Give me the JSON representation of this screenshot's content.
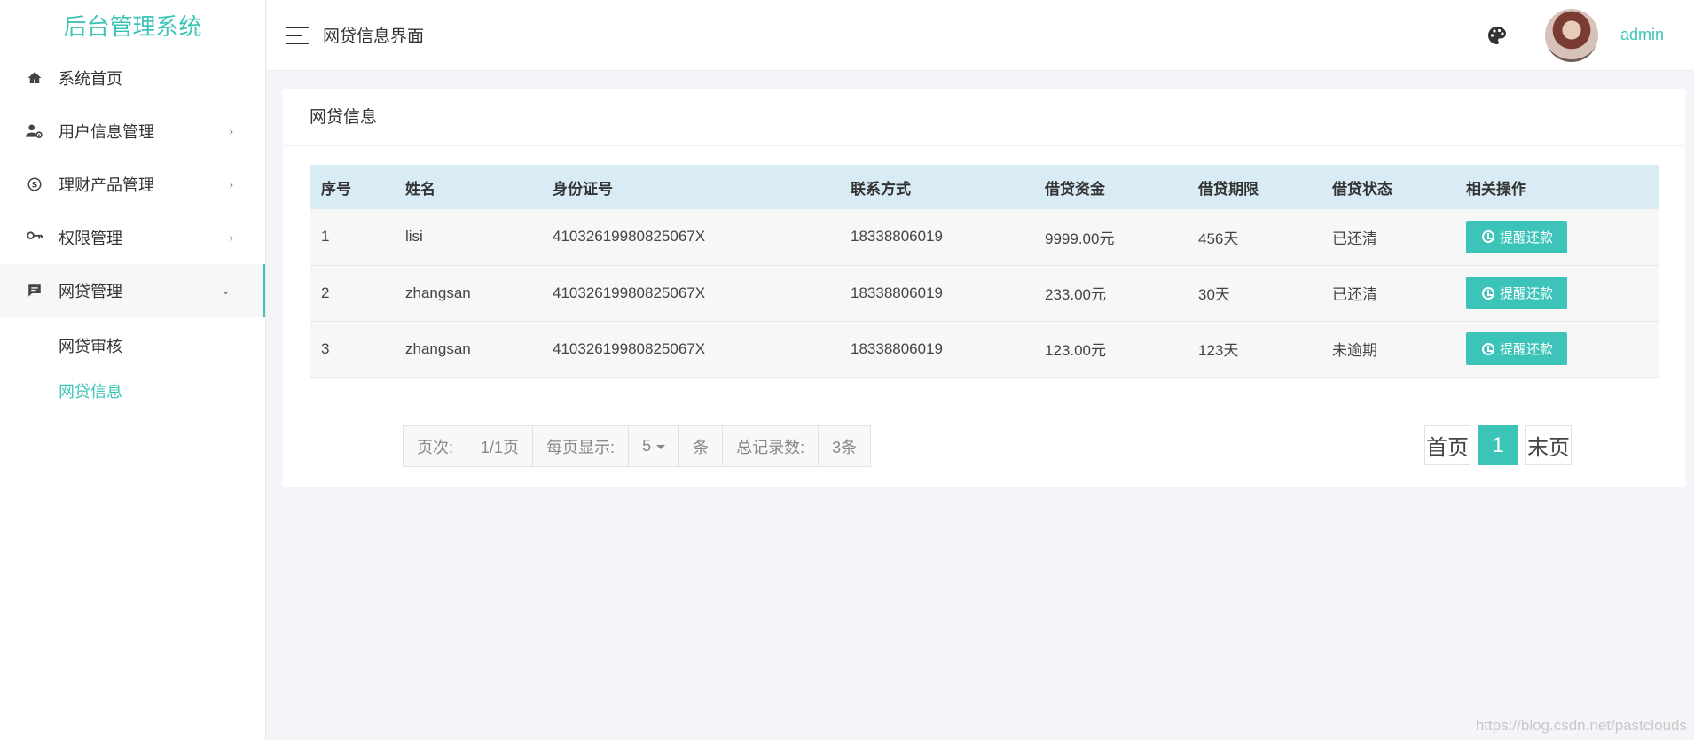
{
  "app": {
    "title": "后台管理系统"
  },
  "sidebar": {
    "items": [
      {
        "label": "系统首页",
        "icon": "home-icon",
        "has_arrow": false
      },
      {
        "label": "用户信息管理",
        "icon": "user-settings-icon",
        "has_arrow": true
      },
      {
        "label": "理财产品管理",
        "icon": "skype-icon",
        "has_arrow": true
      },
      {
        "label": "权限管理",
        "icon": "key-icon",
        "has_arrow": true
      },
      {
        "label": "网贷管理",
        "icon": "message-icon",
        "has_arrow": true,
        "open": true
      }
    ],
    "submenu": [
      {
        "label": "网贷审核",
        "active": false
      },
      {
        "label": "网贷信息",
        "active": true
      }
    ]
  },
  "header": {
    "title": "网贷信息界面",
    "username": "admin"
  },
  "card": {
    "title": "网贷信息"
  },
  "table": {
    "columns": [
      "序号",
      "姓名",
      "身份证号",
      "联系方式",
      "借贷资金",
      "借贷期限",
      "借贷状态",
      "相关操作"
    ],
    "rows": [
      {
        "index": "1",
        "name": "lisi",
        "id_number": "41032619980825067X",
        "phone": "18338806019",
        "amount": "9999.00元",
        "term": "456天",
        "status": "已还清",
        "action": "提醒还款"
      },
      {
        "index": "2",
        "name": "zhangsan",
        "id_number": "41032619980825067X",
        "phone": "18338806019",
        "amount": "233.00元",
        "term": "30天",
        "status": "已还清",
        "action": "提醒还款"
      },
      {
        "index": "3",
        "name": "zhangsan",
        "id_number": "41032619980825067X",
        "phone": "18338806019",
        "amount": "123.00元",
        "term": "123天",
        "status": "未逾期",
        "action": "提醒还款"
      }
    ]
  },
  "pagination": {
    "page_label": "页次:",
    "page_value": "1/1页",
    "per_page_label": "每页显示:",
    "per_page_value": "5",
    "per_page_unit": "条",
    "total_label": "总记录数:",
    "total_value": "3条",
    "first": "首页",
    "current": "1",
    "last": "末页"
  },
  "watermark": "https://blog.csdn.net/pastclouds",
  "colors": {
    "accent": "#3dc4b8",
    "table_header": "#d9ecf5",
    "background": "#f4f5f8"
  }
}
